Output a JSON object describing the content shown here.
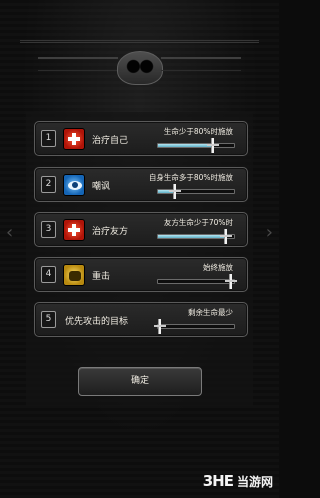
{
  "panel": {
    "confirm_label": "确定"
  },
  "slots": [
    {
      "num": "1",
      "icon": "heal-icon",
      "name": "治疗自己",
      "condition": "生命少于80%时施放",
      "level": 0.72
    },
    {
      "num": "2",
      "icon": "taunt-eye-icon",
      "name": "嘲讽",
      "condition": "自身生命多于80%时施放",
      "level": 0.22
    },
    {
      "num": "3",
      "icon": "heal-icon",
      "name": "治疗友方",
      "condition": "友方生命少于70%时",
      "level": 0.9
    },
    {
      "num": "4",
      "icon": "strike-fist-icon",
      "name": "重击",
      "condition": "始终施放",
      "level": 0.96
    },
    {
      "num": "5",
      "icon": "",
      "name": "优先攻击的目标",
      "condition": "剩余生命最少",
      "level": 0.03
    }
  ],
  "watermark": {
    "logo": "3HE",
    "site": "当游网"
  }
}
